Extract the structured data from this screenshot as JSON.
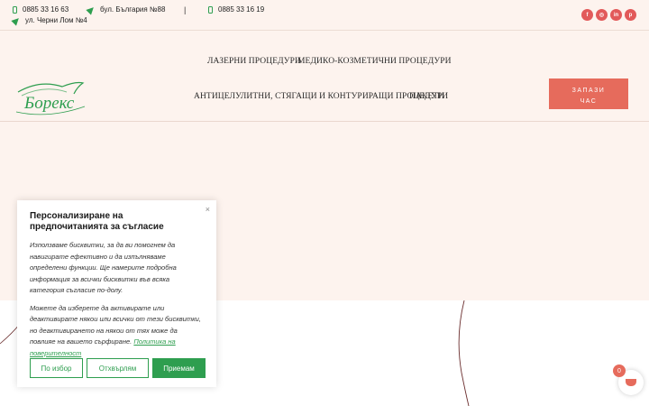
{
  "topbar": {
    "phone1": "0885 33 16 63",
    "address1": "бул. България №88",
    "separator": "|",
    "phone2": "0885 33 16 19",
    "address2": "ул. Черни Лом №4"
  },
  "socials": [
    "facebook-icon",
    "instagram-icon",
    "linkedin-icon",
    "pinterest-icon"
  ],
  "brand": {
    "logo_text": "Борекс"
  },
  "nav": {
    "item1": "ЛАЗЕРНИ ПРОЦЕДУРИ",
    "item2": "МЕДИКО-КОЗМЕТИЧНИ ПРОЦЕДУРИ",
    "item3": "АНТИЦЕЛУЛИТНИ, СТЯГАЩИ И КОНТУРИРАЩИ ПРОЦЕДУРИ",
    "item4": "ПАКЕТИ",
    "book_line1": "ЗАПАЗИ",
    "book_line2": "ЧАС"
  },
  "cookie": {
    "close": "×",
    "title": "Персонализиране на предпочитанията за съгласие",
    "text1": "Използваме бисквитки, за да ви помогнем да навигирате ефективно и да изпълняваме определени функции. Ще намерите подробна информация за всички бисквитки във всяка категория съгласие по-долу.",
    "text2": "Можете да изберете да активирате или деактивирате някои или всички от тези бисквитки, но деактивирането на някои от тях може да повлияе на вашето сърфиране.",
    "link": "Политика на поверителност",
    "btn_custom": "По избор",
    "btn_reject": "Отхвърлям",
    "btn_accept": "Приемам"
  },
  "cart": {
    "count": "0"
  },
  "colors": {
    "accent": "#e66b5c",
    "brand_green": "#2e9e4f",
    "bg": "#fdf3ee"
  }
}
